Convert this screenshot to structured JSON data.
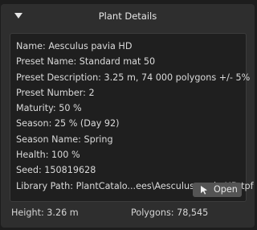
{
  "panel": {
    "title": "Plant Details"
  },
  "info": {
    "lines": [
      "Name: Aesculus pavia HD",
      "Preset Name: Standard mat 50",
      "Preset Description: 3.25 m, 74 000 polygons +/- 5%",
      "Preset Number: 2",
      "Maturity: 50 %",
      "Season: 25 % (Day 92)",
      "Season Name: Spring",
      "Health: 100 %",
      "Seed: 150819628",
      "Library Path: PlantCatalo...ees\\Aesculus pavia HD.tpf"
    ],
    "open_button_label": "Open",
    "open_button_icon": "cursor-arrow-icon"
  },
  "footer": {
    "height": "Height: 3.26 m",
    "polygons": "Polygons: 78,545"
  },
  "colors": {
    "background": "#1d1d1d",
    "panel": "#2e2e2e",
    "info_box": "#1f1f1f",
    "button": "#545454",
    "text": "#dcdcdc"
  }
}
